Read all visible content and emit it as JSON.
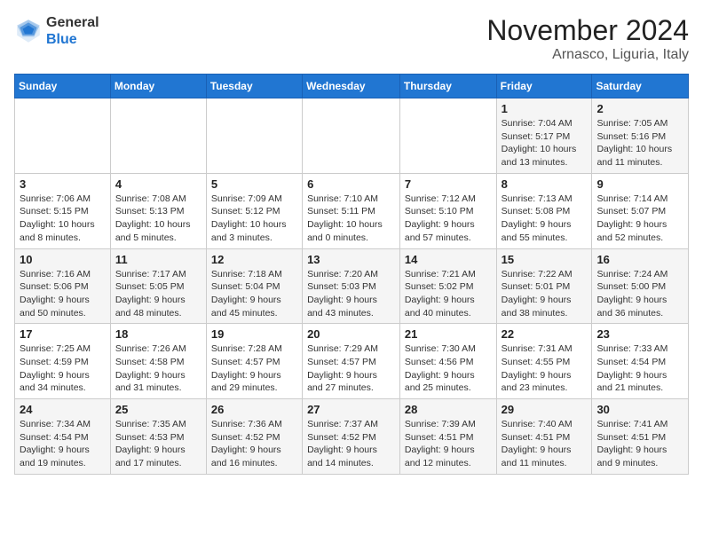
{
  "logo": {
    "general": "General",
    "blue": "Blue"
  },
  "header": {
    "month": "November 2024",
    "location": "Arnasco, Liguria, Italy"
  },
  "weekdays": [
    "Sunday",
    "Monday",
    "Tuesday",
    "Wednesday",
    "Thursday",
    "Friday",
    "Saturday"
  ],
  "weeks": [
    [
      {
        "day": "",
        "info": ""
      },
      {
        "day": "",
        "info": ""
      },
      {
        "day": "",
        "info": ""
      },
      {
        "day": "",
        "info": ""
      },
      {
        "day": "",
        "info": ""
      },
      {
        "day": "1",
        "info": "Sunrise: 7:04 AM\nSunset: 5:17 PM\nDaylight: 10 hours\nand 13 minutes."
      },
      {
        "day": "2",
        "info": "Sunrise: 7:05 AM\nSunset: 5:16 PM\nDaylight: 10 hours\nand 11 minutes."
      }
    ],
    [
      {
        "day": "3",
        "info": "Sunrise: 7:06 AM\nSunset: 5:15 PM\nDaylight: 10 hours\nand 8 minutes."
      },
      {
        "day": "4",
        "info": "Sunrise: 7:08 AM\nSunset: 5:13 PM\nDaylight: 10 hours\nand 5 minutes."
      },
      {
        "day": "5",
        "info": "Sunrise: 7:09 AM\nSunset: 5:12 PM\nDaylight: 10 hours\nand 3 minutes."
      },
      {
        "day": "6",
        "info": "Sunrise: 7:10 AM\nSunset: 5:11 PM\nDaylight: 10 hours\nand 0 minutes."
      },
      {
        "day": "7",
        "info": "Sunrise: 7:12 AM\nSunset: 5:10 PM\nDaylight: 9 hours\nand 57 minutes."
      },
      {
        "day": "8",
        "info": "Sunrise: 7:13 AM\nSunset: 5:08 PM\nDaylight: 9 hours\nand 55 minutes."
      },
      {
        "day": "9",
        "info": "Sunrise: 7:14 AM\nSunset: 5:07 PM\nDaylight: 9 hours\nand 52 minutes."
      }
    ],
    [
      {
        "day": "10",
        "info": "Sunrise: 7:16 AM\nSunset: 5:06 PM\nDaylight: 9 hours\nand 50 minutes."
      },
      {
        "day": "11",
        "info": "Sunrise: 7:17 AM\nSunset: 5:05 PM\nDaylight: 9 hours\nand 48 minutes."
      },
      {
        "day": "12",
        "info": "Sunrise: 7:18 AM\nSunset: 5:04 PM\nDaylight: 9 hours\nand 45 minutes."
      },
      {
        "day": "13",
        "info": "Sunrise: 7:20 AM\nSunset: 5:03 PM\nDaylight: 9 hours\nand 43 minutes."
      },
      {
        "day": "14",
        "info": "Sunrise: 7:21 AM\nSunset: 5:02 PM\nDaylight: 9 hours\nand 40 minutes."
      },
      {
        "day": "15",
        "info": "Sunrise: 7:22 AM\nSunset: 5:01 PM\nDaylight: 9 hours\nand 38 minutes."
      },
      {
        "day": "16",
        "info": "Sunrise: 7:24 AM\nSunset: 5:00 PM\nDaylight: 9 hours\nand 36 minutes."
      }
    ],
    [
      {
        "day": "17",
        "info": "Sunrise: 7:25 AM\nSunset: 4:59 PM\nDaylight: 9 hours\nand 34 minutes."
      },
      {
        "day": "18",
        "info": "Sunrise: 7:26 AM\nSunset: 4:58 PM\nDaylight: 9 hours\nand 31 minutes."
      },
      {
        "day": "19",
        "info": "Sunrise: 7:28 AM\nSunset: 4:57 PM\nDaylight: 9 hours\nand 29 minutes."
      },
      {
        "day": "20",
        "info": "Sunrise: 7:29 AM\nSunset: 4:57 PM\nDaylight: 9 hours\nand 27 minutes."
      },
      {
        "day": "21",
        "info": "Sunrise: 7:30 AM\nSunset: 4:56 PM\nDaylight: 9 hours\nand 25 minutes."
      },
      {
        "day": "22",
        "info": "Sunrise: 7:31 AM\nSunset: 4:55 PM\nDaylight: 9 hours\nand 23 minutes."
      },
      {
        "day": "23",
        "info": "Sunrise: 7:33 AM\nSunset: 4:54 PM\nDaylight: 9 hours\nand 21 minutes."
      }
    ],
    [
      {
        "day": "24",
        "info": "Sunrise: 7:34 AM\nSunset: 4:54 PM\nDaylight: 9 hours\nand 19 minutes."
      },
      {
        "day": "25",
        "info": "Sunrise: 7:35 AM\nSunset: 4:53 PM\nDaylight: 9 hours\nand 17 minutes."
      },
      {
        "day": "26",
        "info": "Sunrise: 7:36 AM\nSunset: 4:52 PM\nDaylight: 9 hours\nand 16 minutes."
      },
      {
        "day": "27",
        "info": "Sunrise: 7:37 AM\nSunset: 4:52 PM\nDaylight: 9 hours\nand 14 minutes."
      },
      {
        "day": "28",
        "info": "Sunrise: 7:39 AM\nSunset: 4:51 PM\nDaylight: 9 hours\nand 12 minutes."
      },
      {
        "day": "29",
        "info": "Sunrise: 7:40 AM\nSunset: 4:51 PM\nDaylight: 9 hours\nand 11 minutes."
      },
      {
        "day": "30",
        "info": "Sunrise: 7:41 AM\nSunset: 4:51 PM\nDaylight: 9 hours\nand 9 minutes."
      }
    ]
  ]
}
